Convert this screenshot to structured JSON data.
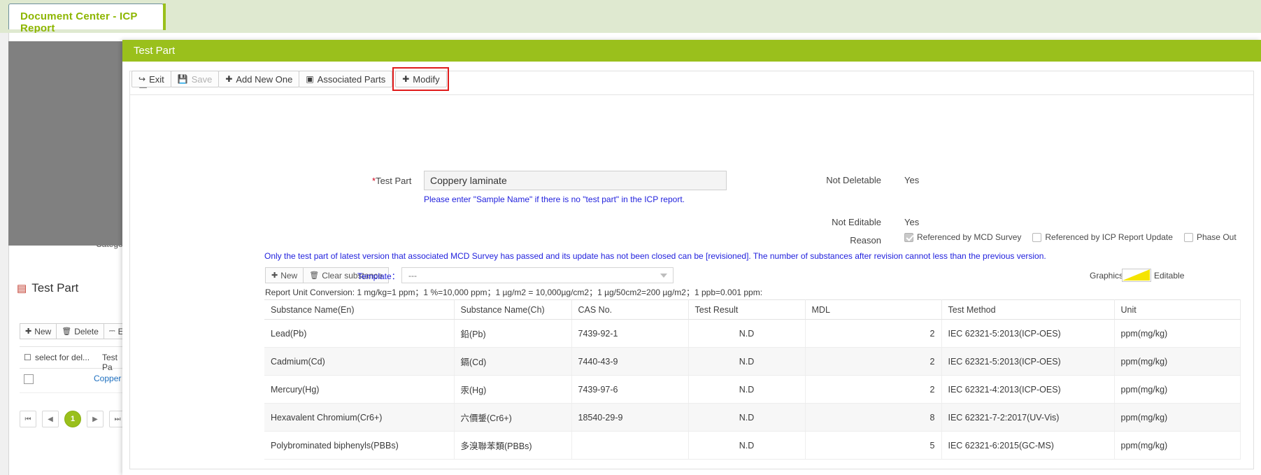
{
  "tab": {
    "label": "Document Center - ICP Report"
  },
  "modal": {
    "title": "Test Part",
    "section_title": "Test Part",
    "toolbar": [
      {
        "name": "exit",
        "icon": "exit-icon",
        "glyph": "↪",
        "label": "Exit",
        "disabled": false,
        "highlighted": false
      },
      {
        "name": "save",
        "icon": "save-icon",
        "glyph": "Ὃe",
        "label": "Save",
        "disabled": true,
        "highlighted": false
      },
      {
        "name": "add-new-one",
        "icon": "plus-icon",
        "glyph": "✚",
        "label": "Add New One",
        "disabled": false,
        "highlighted": false
      },
      {
        "name": "associated-parts",
        "icon": "document-icon",
        "glyph": "☰",
        "label": "Associated Parts",
        "disabled": false,
        "highlighted": false
      },
      {
        "name": "modify",
        "icon": "plus-icon",
        "glyph": "✚",
        "label": "Modify",
        "disabled": false,
        "highlighted": true
      }
    ],
    "form": {
      "test_part_label": "Test Part",
      "test_part_required_mark": "*",
      "test_part_value": "Coppery laminate",
      "test_part_hint": "Please enter \"Sample Name\" if there is no \"test part\" in the ICP report.",
      "not_deletable_label": "Not Deletable",
      "not_deletable_value": "Yes",
      "not_editable_label": "Not Editable",
      "not_editable_value": "Yes",
      "reason_label": "Reason",
      "reason_checkboxes": [
        {
          "label": "Referenced by MCD Survey",
          "checked": true
        },
        {
          "label": "Referenced by ICP Report Update",
          "checked": false
        },
        {
          "label": "Phase Out",
          "checked": false
        }
      ]
    },
    "revision_notice": "Only the test part of latest version that associated MCD Survey has passed and its update has not been closed can be [revisioned]. The number of substances after revision cannot less than the previous version.",
    "substance_toolbar": [
      {
        "name": "new",
        "icon": "plus-icon",
        "glyph": "✚",
        "label": "New"
      },
      {
        "name": "clear-substance",
        "icon": "trash-icon",
        "glyph": "Ὕ1",
        "label": "Clear substance"
      }
    ],
    "template": {
      "label": "Template：",
      "value": "---"
    },
    "graphics": {
      "label": "Graphics:",
      "editable_label": "Editable"
    },
    "unit_conversion": "Report Unit Conversion: 1 mg/kg=1 ppm；1 %=10,000 ppm；1 µg/m2 = 10,000µg/cm2；1 µg/50cm2=200 µg/m2；1 ppb=0.001 ppm:",
    "table": {
      "columns": [
        "Substance Name(En)",
        "Substance Name(Ch)",
        "CAS No.",
        "Test Result",
        "MDL",
        "Test Method",
        "Unit"
      ],
      "rows": [
        {
          "name_en": "Lead(Pb)",
          "name_ch": "鉛(Pb)",
          "cas": "7439-92-1",
          "result": "N.D",
          "mdl": "2",
          "method": "IEC 62321-5:2013(ICP-OES)",
          "unit": "ppm(mg/kg)"
        },
        {
          "name_en": "Cadmium(Cd)",
          "name_ch": "鎘(Cd)",
          "cas": "7440-43-9",
          "result": "N.D",
          "mdl": "2",
          "method": "IEC 62321-5:2013(ICP-OES)",
          "unit": "ppm(mg/kg)"
        },
        {
          "name_en": "Mercury(Hg)",
          "name_ch": "汞(Hg)",
          "cas": "7439-97-6",
          "result": "N.D",
          "mdl": "2",
          "method": "IEC 62321-4:2013(ICP-OES)",
          "unit": "ppm(mg/kg)"
        },
        {
          "name_en": "Hexavalent Chromium(Cr6+)",
          "name_ch": "六價鋬(Cr6+)",
          "cas": "18540-29-9",
          "result": "N.D",
          "mdl": "8",
          "method": "IEC 62321-7-2:2017(UV-Vis)",
          "unit": "ppm(mg/kg)"
        },
        {
          "name_en": "Polybrominated biphenyls(PBBs)",
          "name_ch": "多溴聯苯類(PBBs)",
          "cas": "",
          "result": "N.D",
          "mdl": "5",
          "method": "IEC 62321-6:2015(GC-MS)",
          "unit": "ppm(mg/kg)"
        }
      ]
    }
  },
  "background": {
    "category_label": "Category",
    "section_title": "Test Part",
    "toolbar": [
      {
        "name": "new",
        "glyph": "✚",
        "label": "New"
      },
      {
        "name": "delete",
        "glyph": "Ὕ1",
        "label": "Delete"
      },
      {
        "name": "export",
        "glyph": "⤓",
        "label": "Expo"
      }
    ],
    "table_headers": [
      "select for del...",
      "Test Pa"
    ],
    "row_link": "Copper",
    "pager": {
      "first": "⏮",
      "prev": "◀",
      "current": "1",
      "next": "▶",
      "last": "⏭"
    }
  }
}
